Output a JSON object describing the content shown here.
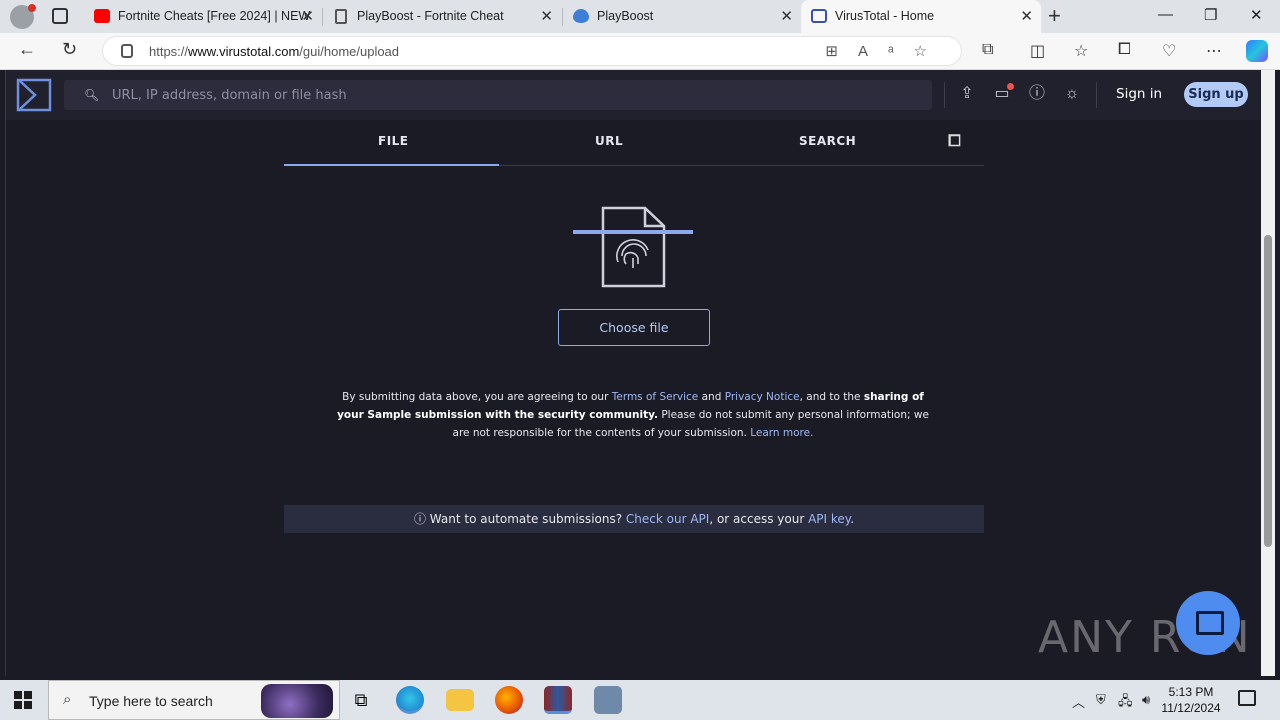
{
  "browser": {
    "tabs": [
      {
        "title": "Fortnite Cheats [Free 2024] | NEW",
        "favicon": "youtube-icon",
        "color": "#ff0000"
      },
      {
        "title": "PlayBoost - Fortnite Cheat",
        "favicon": "page-icon",
        "color": "#555555"
      },
      {
        "title": "PlayBoost",
        "favicon": "playboost-icon",
        "color": "#3d7fd6"
      },
      {
        "title": "VirusTotal - Home",
        "favicon": "virustotal-icon",
        "color": "#3954a5"
      }
    ],
    "close_glyph": "✕",
    "new_tab_glyph": "+",
    "url_prefix": "https://",
    "url_host": "www.virustotal.com",
    "url_path": "/gui/home/upload"
  },
  "vt": {
    "search_placeholder": "URL, IP address, domain or file hash",
    "sign_in": "Sign in",
    "sign_up": "Sign up",
    "tabs": [
      "FILE",
      "URL",
      "SEARCH"
    ],
    "choose_file": "Choose file",
    "terms": {
      "t1": "By submitting data above, you are agreeing to our ",
      "tos": "Terms of Service",
      "t2": " and ",
      "privacy": "Privacy Notice",
      "t3": ", and to the ",
      "bold": "sharing of your Sample submission with the security community.",
      "t4": " Please do not submit any personal information; we are not responsible for the contents of your submission. ",
      "learn": "Learn more."
    },
    "api": {
      "t1": "Want to automate submissions? ",
      "link1": "Check our API",
      "t2": ", or access your ",
      "link2": "API key",
      "t3": "."
    },
    "accent": "#8ea8ec"
  },
  "watermark": "ANY RUN",
  "taskbar": {
    "search_placeholder": "Type here to search",
    "time": "5:13 PM",
    "date": "11/12/2024"
  }
}
